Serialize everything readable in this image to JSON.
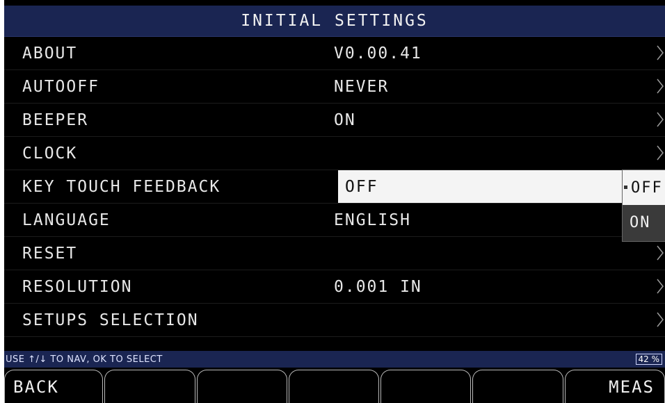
{
  "title": "INITIAL SETTINGS",
  "menu": {
    "items": [
      {
        "label": "ABOUT",
        "value": "V0.00.41"
      },
      {
        "label": "AUTOOFF",
        "value": "NEVER"
      },
      {
        "label": "BEEPER",
        "value": "ON"
      },
      {
        "label": "CLOCK",
        "value": ""
      },
      {
        "label": "KEY TOUCH FEEDBACK",
        "value": "OFF"
      },
      {
        "label": "LANGUAGE",
        "value": "ENGLISH"
      },
      {
        "label": "RESET",
        "value": ""
      },
      {
        "label": "RESOLUTION",
        "value": "0.001 IN"
      },
      {
        "label": "SETUPS SELECTION",
        "value": ""
      }
    ]
  },
  "dropdown": {
    "options": [
      "OFF",
      "ON"
    ],
    "selected": "OFF"
  },
  "status": {
    "hint": "USE ↑/↓ TO NAV, OK TO SELECT",
    "battery": "42 %"
  },
  "softkeys": [
    "BACK",
    "",
    "",
    "",
    "",
    "",
    "MEAS"
  ],
  "colors": {
    "title_bar": "#1a2552",
    "background": "#000000",
    "highlight": "#f4f4f4"
  }
}
